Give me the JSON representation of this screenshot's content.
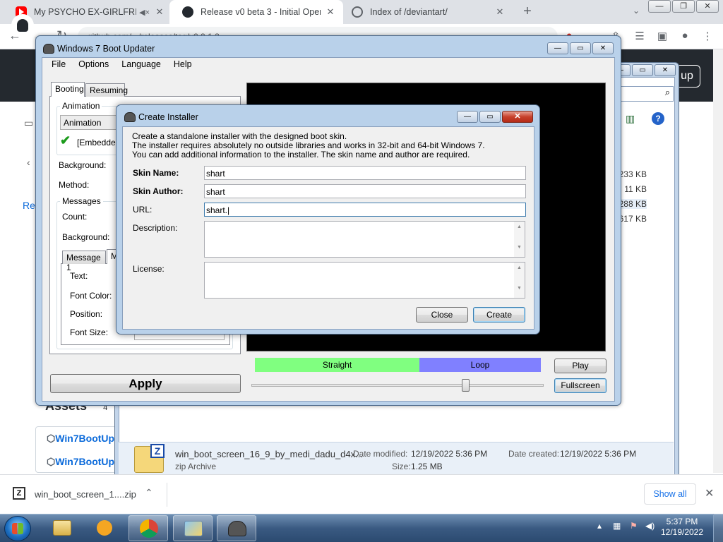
{
  "browser": {
    "tabs": [
      {
        "title": "My PSYCHO EX-GIRLFRIEND",
        "active": false
      },
      {
        "title": "Release v0 beta 3 - Initial Open-S",
        "active": true
      },
      {
        "title": "Index of /deviantart/",
        "active": false
      }
    ],
    "new_tab": "+",
    "address": "github.com/.../releases/tag/v0.9.1.3",
    "window_controls": [
      "—",
      "❐",
      "✕"
    ]
  },
  "github": {
    "sign_up_fragment": "up",
    "left_link_fragment": "Rel",
    "assets_label": "Assets",
    "assets_count": "4",
    "asset_links": [
      "Win7BootUp",
      "Win7BootUp"
    ]
  },
  "explorer": {
    "sizes": [
      "233 KB",
      "11 KB",
      "288 KB",
      "617 KB"
    ],
    "file_name": "win_boot_screen_16_9_by_medi_dadu_d4x...",
    "file_type": "zip Archive",
    "date_modified_label": "Date modified:",
    "date_modified": "12/19/2022 5:36 PM",
    "date_created_label": "Date created:",
    "date_created": "12/19/2022 5:36 PM",
    "size_label": "Size:",
    "size": "1.25 MB"
  },
  "boot_updater": {
    "title": "Windows 7 Boot Updater",
    "menu": [
      "File",
      "Options",
      "Language",
      "Help"
    ],
    "tabs": [
      "Booting",
      "Resuming"
    ],
    "animation_group": "Animation",
    "animation_value": "Animation",
    "embedded_label": "[Embedded]",
    "background_label": "Background:",
    "method_label": "Method:",
    "messages_group": "Messages",
    "count_label": "Count:",
    "messages_background_label": "Background:",
    "message_tabs": [
      "Message 1",
      "M"
    ],
    "text_label": "Text:",
    "font_color_label": "Font Color:",
    "position_label": "Position:",
    "font_size_label": "Font Size:",
    "apply_button": "Apply",
    "segments": [
      {
        "label": "Straight",
        "color": "#80ff80"
      },
      {
        "label": "Loop",
        "color": "#8080ff"
      }
    ],
    "play_button": "Play",
    "fullscreen_button": "Fullscreen",
    "slider_position": 0.73
  },
  "dialog": {
    "title": "Create Installer",
    "description_lines": [
      "Create a standalone installer with the designed boot skin.",
      "The installer requires absolutely no outside libraries and works in 32-bit and 64-bit Windows 7.",
      "You can add additional information to the installer. The skin name and author are required."
    ],
    "skin_name_label": "Skin Name:",
    "skin_name_value": "shart",
    "skin_author_label": "Skin Author:",
    "skin_author_value": "shart",
    "url_label": "URL:",
    "url_value": "shart.|",
    "description_label": "Description:",
    "license_label": "License:",
    "close_button": "Close",
    "create_button": "Create"
  },
  "download_bar": {
    "file": "win_boot_screen_1....zip",
    "show_all": "Show all"
  },
  "taskbar": {
    "time": "5:37 PM",
    "date": "12/19/2022"
  }
}
